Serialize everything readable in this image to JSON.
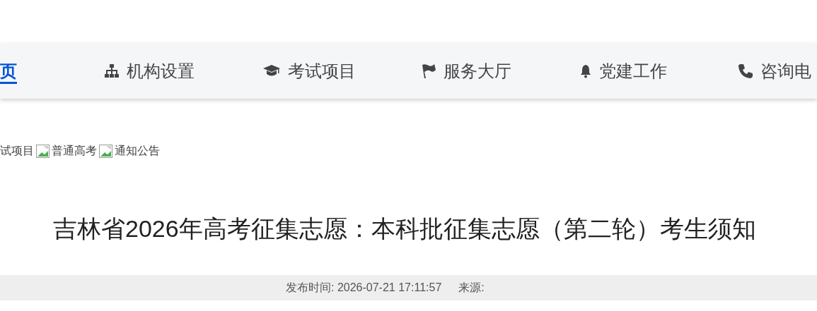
{
  "nav": {
    "items": [
      {
        "label": "页",
        "selected": true
      },
      {
        "label": "机构设置",
        "selected": false
      },
      {
        "label": "考试项目",
        "selected": false
      },
      {
        "label": "服务大厅",
        "selected": false
      },
      {
        "label": "党建工作",
        "selected": false
      },
      {
        "label": "咨询电",
        "selected": false
      }
    ]
  },
  "breadcrumb": [
    "试项目",
    "普通高考",
    "通知公告"
  ],
  "article": {
    "title": "吉林省2026年高考征集志愿：本科批征集志愿（第二轮）考生须知",
    "published": "发布时间: 2026-07-21 17:11:57",
    "source": "来源:"
  }
}
